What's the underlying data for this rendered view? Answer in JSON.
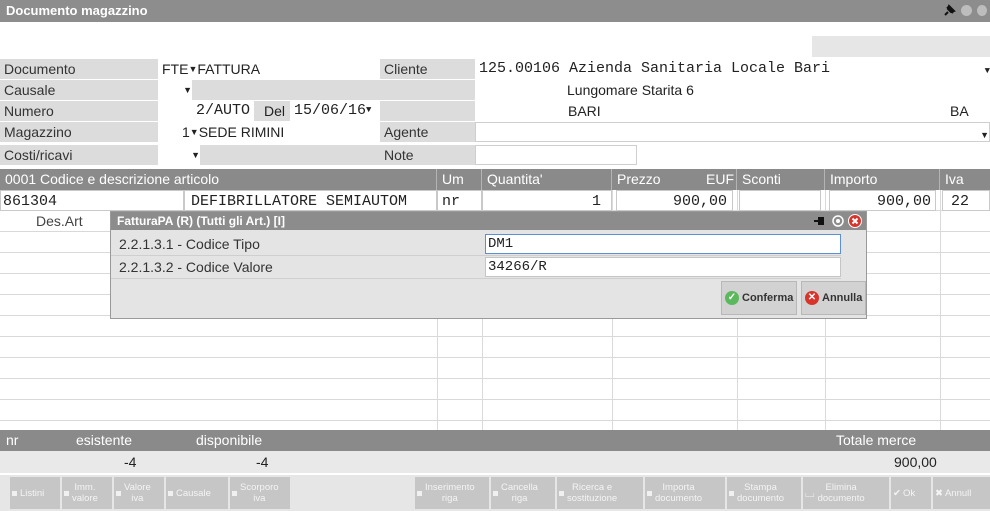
{
  "window": {
    "title": "Documento magazzino"
  },
  "header": {
    "documento_label": "Documento",
    "documento_code": "FTE",
    "documento_desc": "FATTURA",
    "cliente_label": "Cliente",
    "cliente_value": "125.00106 Azienda Sanitaria Locale Bari",
    "indirizzo": "Lungomare Starita 6",
    "citta": "BARI",
    "provincia": "BA",
    "causale_label": "Causale",
    "numero_label": "Numero",
    "numero_value": "2/AUTO",
    "del_label": "Del",
    "data_value": "15/06/16",
    "magazzino_label": "Magazzino",
    "magazzino_code": "1",
    "magazzino_desc": "SEDE RIMINI",
    "agente_label": "Agente",
    "costi_label": "Costi/ricavi",
    "note_label": "Note"
  },
  "grid": {
    "columns": {
      "codice": "0001  Codice e descrizione articolo",
      "um": "Um",
      "quantita": "Quantita'",
      "prezzo": "Prezzo",
      "valuta": "EUF",
      "sconti": "Sconti",
      "importo": "Importo",
      "iva": "Iva"
    },
    "row": {
      "codice": "861304",
      "descrizione": "DEFIBRILLATORE SEMIAUTOM",
      "um": "nr",
      "quantita": "1",
      "prezzo": "900,00",
      "sconti": "",
      "importo": "900,00",
      "iva": "22"
    },
    "des_art_label": "Des.Art"
  },
  "dialog": {
    "title": "FatturaPA (R) (Tutti gli Art.) [I]",
    "fields": [
      {
        "label": "2.2.1.3.1 - Codice Tipo",
        "value": "DM1"
      },
      {
        "label": "2.2.1.3.2 - Codice Valore",
        "value": "34266/R"
      }
    ],
    "confirm_label": "Conferma",
    "cancel_label": "Annulla",
    "colors": {
      "confirm": "#5cb85c",
      "cancel": "#d9342b"
    }
  },
  "footer": {
    "um_label": "nr",
    "esistente_label": "esistente",
    "disponibile_label": "disponibile",
    "totale_label": "Totale merce",
    "esistente_value": "-4",
    "disponibile_value": "-4",
    "totale_value": "900,00"
  },
  "toolbar": {
    "listini": "Listini",
    "imm_valore_1": "Imm.",
    "imm_valore_2": "valore",
    "valore_iva_1": "Valore",
    "valore_iva_2": "iva",
    "causale": "Causale",
    "scorporo_1": "Scorporo",
    "scorporo_2": "iva",
    "inserimento_1": "Inserimento",
    "inserimento_2": "riga",
    "cancella_1": "Cancella",
    "cancella_2": "riga",
    "ricerca_1": "Ricerca e",
    "ricerca_2": "sostituzione",
    "importa_1": "Importa",
    "importa_2": "documento",
    "stampa_1": "Stampa",
    "stampa_2": "documento",
    "elimina_1": "Elimina",
    "elimina_2": "documento",
    "ok": "Ok",
    "annulla": "Annull"
  }
}
